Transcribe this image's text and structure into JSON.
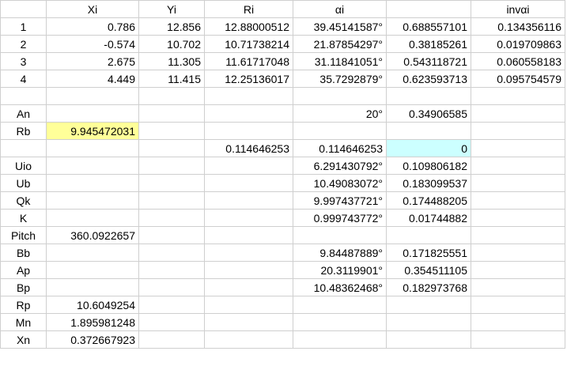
{
  "colors": {
    "grid_line": "#cfcfcf",
    "highlight_yellow": "#ffff99",
    "highlight_cyan": "#ccffff"
  },
  "rows": [
    [
      "",
      "Xi",
      "Yi",
      "Ri",
      "αi",
      "",
      "invαi"
    ],
    [
      "1",
      "0.786",
      "12.856",
      "12.88000512",
      "39.45141587°",
      "0.688557101",
      "0.134356116"
    ],
    [
      "2",
      "-0.574",
      "10.702",
      "10.71738214",
      "21.87854297°",
      "0.38185261",
      "0.019709863"
    ],
    [
      "3",
      "2.675",
      "11.305",
      "11.61717048",
      "31.11841051°",
      "0.543118721",
      "0.060558183"
    ],
    [
      "4",
      "4.449",
      "11.415",
      "12.25136017",
      "35.7292879°",
      "0.623593713",
      "0.095754579"
    ],
    [
      "",
      "",
      "",
      "",
      "",
      "",
      ""
    ],
    [
      "An",
      "",
      "",
      "",
      "20°",
      "0.34906585",
      ""
    ],
    [
      "Rb",
      "9.945472031",
      "",
      "",
      "",
      "",
      ""
    ],
    [
      "",
      "",
      "",
      "0.114646253",
      "0.114646253",
      "0",
      ""
    ],
    [
      "Uio",
      "",
      "",
      "",
      "6.291430792°",
      "0.109806182",
      ""
    ],
    [
      "Ub",
      "",
      "",
      "",
      "10.49083072°",
      "0.183099537",
      ""
    ],
    [
      "Qk",
      "",
      "",
      "",
      "9.997437721°",
      "0.174488205",
      ""
    ],
    [
      "K",
      "",
      "",
      "",
      "0.999743772°",
      "0.01744882",
      ""
    ],
    [
      "Pitch",
      "360.0922657",
      "",
      "",
      "",
      "",
      ""
    ],
    [
      "Bb",
      "",
      "",
      "",
      "9.84487889°",
      "0.171825551",
      ""
    ],
    [
      "Ap",
      "",
      "",
      "",
      "20.3119901°",
      "0.354511105",
      ""
    ],
    [
      "Bp",
      "",
      "",
      "",
      "10.48362468°",
      "0.182973768",
      ""
    ],
    [
      "Rp",
      "10.6049254",
      "",
      "",
      "",
      "",
      ""
    ],
    [
      "Mn",
      "1.895981248",
      "",
      "",
      "",
      "",
      ""
    ],
    [
      "Xn",
      "0.372667923",
      "",
      "",
      "",
      "",
      ""
    ]
  ]
}
